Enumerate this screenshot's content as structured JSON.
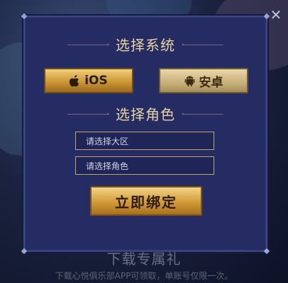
{
  "dialog": {
    "close_icon": "close-icon",
    "system_title": "选择系统",
    "system_options": [
      {
        "label": "iOS",
        "icon": "apple-icon"
      },
      {
        "label": "安卓",
        "icon": "android-icon"
      }
    ],
    "role_title": "选择角色",
    "region_placeholder": "请选择大区",
    "role_placeholder": "请选择角色",
    "bind_button": "立即绑定"
  },
  "background": {
    "gift_title": "下载专属礼",
    "gift_desc": "下载心悦俱乐部APP可领取，单账号仅限一次。"
  },
  "colors": {
    "panel": "#242c63",
    "gold": "#d29a35",
    "title_text": "#e8d3a0"
  }
}
